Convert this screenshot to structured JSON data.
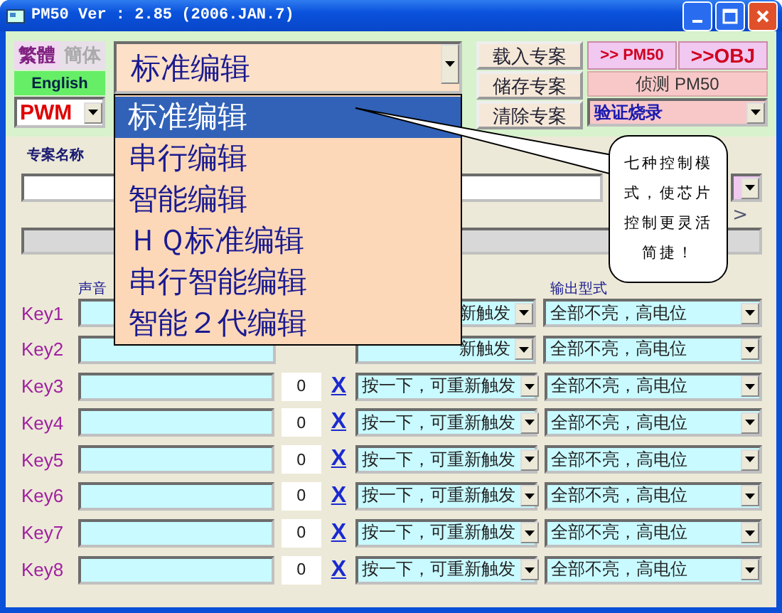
{
  "window": {
    "title": "PM50 Ver : 2.85 (2006.JAN.7)"
  },
  "language": [
    {
      "label": "繁體",
      "selected": true
    },
    {
      "label": "簡体",
      "selected": false
    }
  ],
  "english_button": "English",
  "type_combo": {
    "value": "PWM"
  },
  "mode_combo": {
    "value": "标准编辑",
    "expanded": true,
    "options": [
      {
        "label": "标准编辑",
        "selected": true
      },
      {
        "label": "串行编辑",
        "selected": false
      },
      {
        "label": "智能编辑",
        "selected": false
      },
      {
        "label": "ＨＱ标准编辑",
        "selected": false
      },
      {
        "label": "串行智能编辑",
        "selected": false
      },
      {
        "label": "智能２代编辑",
        "selected": false
      }
    ]
  },
  "project_buttons": [
    "载入专案",
    "储存专案",
    "清除专案"
  ],
  "target_buttons": [
    ">> PM50",
    ">>OBJ"
  ],
  "detect_button": "侦测 PM50",
  "action_combo": {
    "value": "验证烧录"
  },
  "project_name_label": "专案名称",
  "nav_text": ">",
  "columns": [
    "声音",
    "输出型式"
  ],
  "keys": [
    {
      "label": "Key1",
      "mode": "新触发",
      "output": "全部不亮，高电位"
    },
    {
      "label": "Key2",
      "mode": "新触发",
      "output": "全部不亮，高电位"
    },
    {
      "label": "Key3",
      "count": "0",
      "clear": "X",
      "mode": "按一下，可重新触发",
      "output": "全部不亮，高电位"
    },
    {
      "label": "Key4",
      "count": "0",
      "clear": "X",
      "mode": "按一下，可重新触发",
      "output": "全部不亮，高电位"
    },
    {
      "label": "Key5",
      "count": "0",
      "clear": "X",
      "mode": "按一下，可重新触发",
      "output": "全部不亮，高电位"
    },
    {
      "label": "Key6",
      "count": "0",
      "clear": "X",
      "mode": "按一下，可重新触发",
      "output": "全部不亮，高电位"
    },
    {
      "label": "Key7",
      "count": "0",
      "clear": "X",
      "mode": "按一下，可重新触发",
      "output": "全部不亮，高电位"
    },
    {
      "label": "Key8",
      "count": "0",
      "clear": "X",
      "mode": "按一下，可重新触发",
      "output": "全部不亮，高电位"
    }
  ],
  "callout": "七种控制模式，使芯片控制更灵活简捷！"
}
